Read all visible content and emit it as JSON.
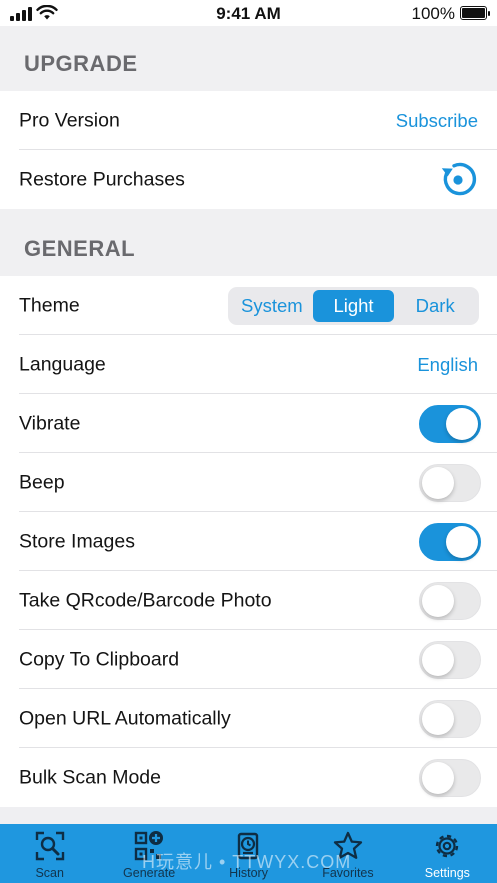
{
  "status_bar": {
    "time": "9:41 AM",
    "battery": "100%"
  },
  "sections": {
    "upgrade": {
      "title": "UPGRADE",
      "pro_version": {
        "label": "Pro Version",
        "action": "Subscribe"
      },
      "restore": {
        "label": "Restore Purchases",
        "icon": "restore-icon"
      }
    },
    "general": {
      "title": "GENERAL",
      "theme": {
        "label": "Theme",
        "options": [
          "System",
          "Light",
          "Dark"
        ],
        "selected": "Light"
      },
      "language": {
        "label": "Language",
        "value": "English"
      },
      "vibrate": {
        "label": "Vibrate",
        "on": true
      },
      "beep": {
        "label": "Beep",
        "on": false
      },
      "store_images": {
        "label": "Store Images",
        "on": true
      },
      "take_photo": {
        "label": "Take QRcode/Barcode Photo",
        "on": false
      },
      "copy_clipboard": {
        "label": "Copy To Clipboard",
        "on": false
      },
      "open_url": {
        "label": "Open URL Automatically",
        "on": false
      },
      "bulk_scan": {
        "label": "Bulk Scan Mode",
        "on": false
      }
    }
  },
  "tab_bar": {
    "tabs": [
      {
        "label": "Scan",
        "icon": "scan-icon"
      },
      {
        "label": "Generate",
        "icon": "generate-icon"
      },
      {
        "label": "History",
        "icon": "history-icon"
      },
      {
        "label": "Favorites",
        "icon": "star-icon"
      },
      {
        "label": "Settings",
        "icon": "gear-icon"
      }
    ],
    "active": "Settings"
  },
  "watermark": "H玩意儿 • TTWYX.COM",
  "colors": {
    "accent": "#1a93db",
    "tab_bar": "#1f97df",
    "background": "#f0f0f2"
  }
}
